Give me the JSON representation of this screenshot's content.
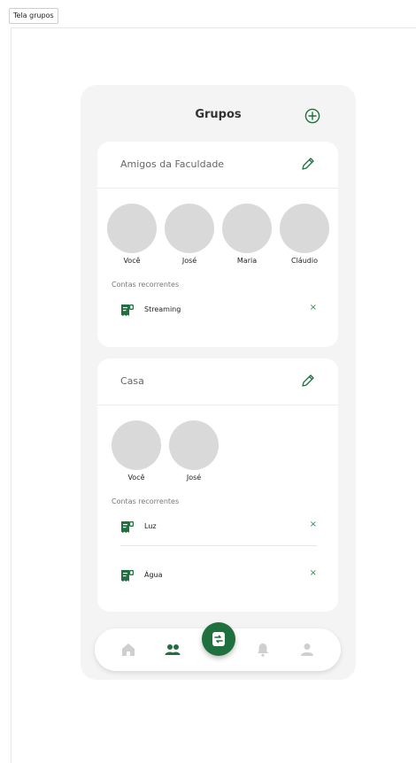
{
  "frame": {
    "label": "Tela grupos"
  },
  "header": {
    "title": "Grupos",
    "add_icon": "plus-circle-icon"
  },
  "colors": {
    "accent": "#1f6f3f",
    "avatar": "#d9d9d9",
    "background": "#f4f4f4"
  },
  "groups": [
    {
      "name": "Amigos da Faculdade",
      "members": [
        "Você",
        "José",
        "Maria",
        "Cláudio"
      ],
      "section_label": "Contas recorrentes",
      "bills": [
        {
          "name": "Streaming",
          "remove": "×"
        }
      ]
    },
    {
      "name": "Casa",
      "members": [
        "Você",
        "José"
      ],
      "section_label": "Contas recorrentes",
      "bills": [
        {
          "name": "Luz",
          "remove": "×"
        },
        {
          "name": "Água",
          "remove": "×"
        }
      ]
    }
  ],
  "nav": {
    "items": [
      "home-icon",
      "groups-icon",
      "split-icon",
      "bell-icon",
      "profile-icon"
    ],
    "active": "groups-icon"
  }
}
